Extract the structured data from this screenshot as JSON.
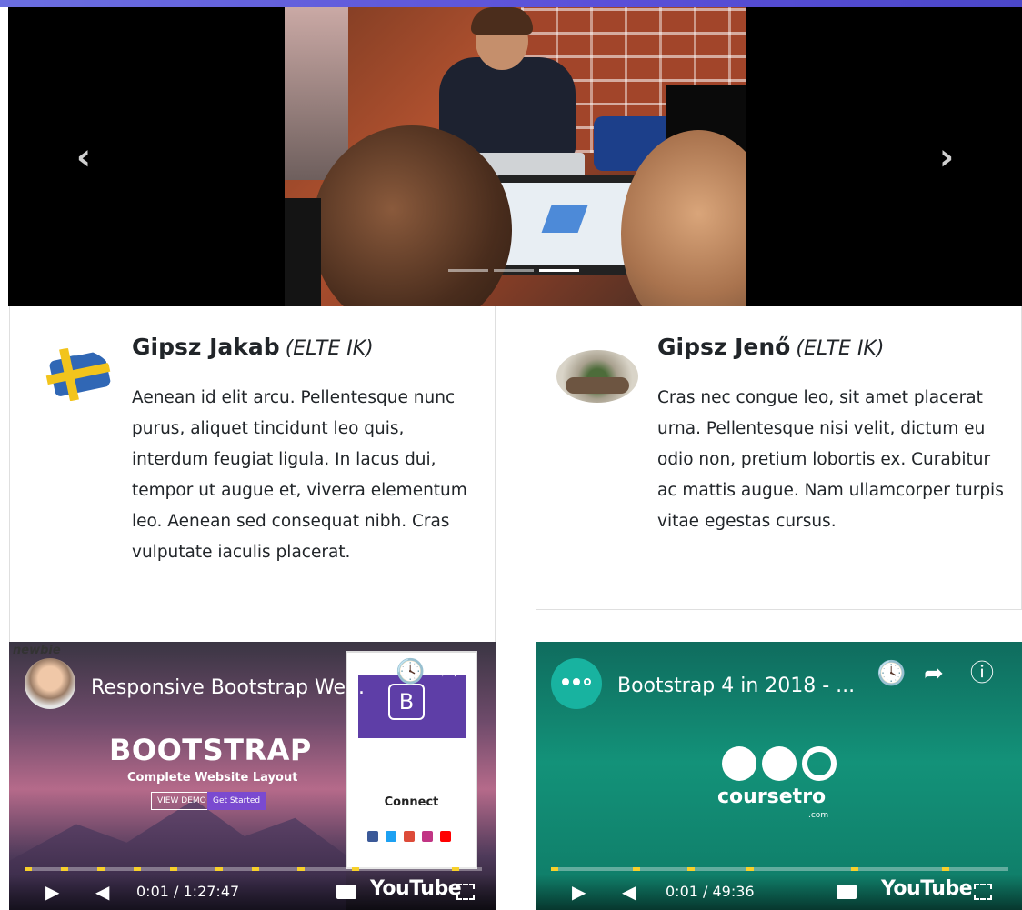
{
  "carousel": {
    "prev_icon": "chevron-left-icon",
    "next_icon": "chevron-right-icon",
    "indicator_count": 3,
    "active_indicator": 3
  },
  "cards": [
    {
      "name": "Gipsz Jakab",
      "affiliation": "(ELTE IK)",
      "text": "Aenean id elit arcu. Pellentesque nunc purus, aliquet tincidunt leo quis, interdum feugiat ligula. In lacus dui, tempor ut augue et, viverra elementum leo. Aenean sed consequat nibh. Cras vulputate iaculis placerat."
    },
    {
      "name": "Gipsz Jenő",
      "affiliation": "(ELTE IK)",
      "text": "Cras nec congue leo, sit amet placerat urna. Pellentesque nisi velit, dictum eu odio non, pretium lobortis ex. Curabitur ac mattis augue. Nam ullamcorper turpis vitae egestas cursus."
    }
  ],
  "videos": [
    {
      "title": "Responsive Bootstrap We...",
      "thumb_heading": "BOOTSTRAP",
      "thumb_sub": "Complete Website Layout",
      "btn_demo": "VIEW DEMO",
      "btn_started": "Get Started",
      "mock_letter": "B",
      "mock_connect": "Connect",
      "time": "0:01 / 1:27:47",
      "brand": "YouTube"
    },
    {
      "title": "Bootstrap 4 in 2018 - ...",
      "logo_text": "coursetro",
      "logo_sub": ".com",
      "time": "0:01 / 49:36",
      "brand": "YouTube"
    }
  ],
  "colors": {
    "accent_bar": "#5a4fd8",
    "progress_marker": "#f7d02a",
    "coursetro_green": "#139279"
  }
}
